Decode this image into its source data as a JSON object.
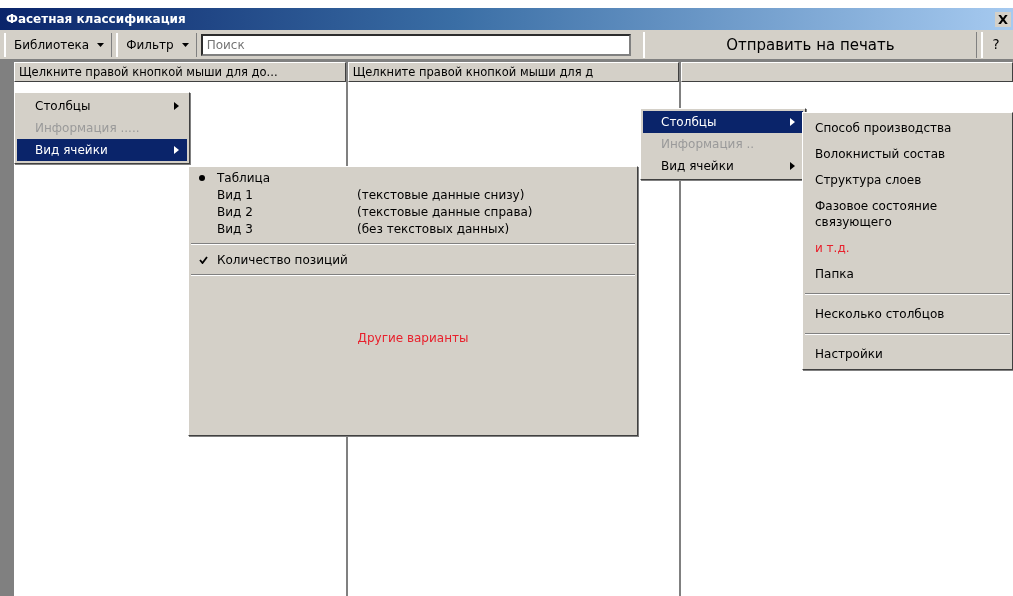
{
  "window": {
    "title": "Фасетная классификация",
    "close": "X"
  },
  "toolbar": {
    "menus": [
      {
        "label": "Библиотека"
      },
      {
        "label": "Фильтр"
      }
    ],
    "search": {
      "placeholder": "Поиск"
    },
    "print_button": "Отправить на печать",
    "help_button": "?"
  },
  "columns": [
    {
      "header": "Щелкните правой кнопкой мыши для до..."
    },
    {
      "header": "Щелкните правой кнопкой мыши для д"
    },
    {}
  ],
  "context_menus": [
    {
      "items": [
        {
          "label": "Столбцы",
          "selected": false,
          "disabled": false,
          "submenu": true
        },
        {
          "label": "Информация .....",
          "selected": false,
          "disabled": true,
          "submenu": false
        },
        {
          "label": "Вид ячейки",
          "selected": true,
          "disabled": false,
          "submenu": true
        }
      ],
      "submenu": [
        {
          "kind": "radio",
          "label": "Таблица",
          "checked": true
        },
        {
          "kind": "view",
          "label": "Вид 1",
          "description": "(текстовые данные снизу)"
        },
        {
          "kind": "view",
          "label": "Вид 2",
          "description": "(текстовые данные справа)"
        },
        {
          "kind": "view",
          "label": "Вид 3",
          "description": "(без текстовых данных)"
        },
        {
          "kind": "separator"
        },
        {
          "kind": "check",
          "label": "Количество позиций",
          "checked": true
        },
        {
          "kind": "separator"
        },
        {
          "kind": "link",
          "label": "Другие варианты",
          "color": "#e8202c"
        }
      ]
    },
    {
      "items": [
        {
          "label": "Столбцы",
          "selected": true,
          "disabled": false,
          "submenu": true
        },
        {
          "label": "Информация  ..",
          "selected": false,
          "disabled": true,
          "submenu": false
        },
        {
          "label": "Вид ячейки",
          "selected": false,
          "disabled": false,
          "submenu": true
        }
      ],
      "submenu": [
        {
          "kind": "item",
          "label": "Способ производства"
        },
        {
          "kind": "item",
          "label": "Волокнистый состав"
        },
        {
          "kind": "item",
          "label": "Структура слоев"
        },
        {
          "kind": "item",
          "label": "Фазовое состояние связующего"
        },
        {
          "kind": "item",
          "label": "и т.д.",
          "color": "#e8202c"
        },
        {
          "kind": "item",
          "label": "Папка"
        },
        {
          "kind": "separator"
        },
        {
          "kind": "item",
          "label": "Несколько столбцов"
        },
        {
          "kind": "separator"
        },
        {
          "kind": "item",
          "label": "Настройки"
        }
      ]
    }
  ]
}
